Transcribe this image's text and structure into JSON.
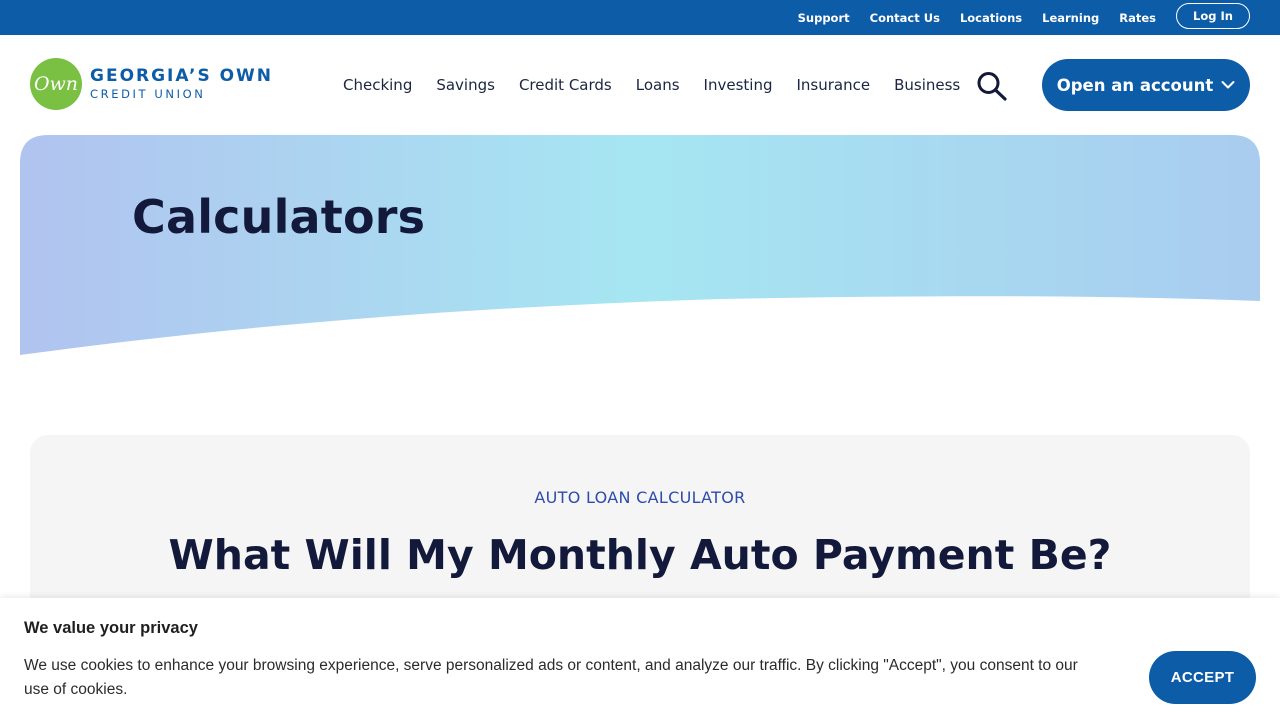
{
  "utility_nav": {
    "links": [
      "Support",
      "Contact Us",
      "Locations",
      "Learning",
      "Rates"
    ],
    "login_label": "Log In"
  },
  "brand": {
    "mark_text": "Own",
    "name_line1": "GEORGIA’S OWN",
    "name_line2": "CREDIT UNION",
    "primary_color": "#0d5ca8",
    "mark_color": "#7ac043"
  },
  "main_nav": {
    "items": [
      "Checking",
      "Savings",
      "Credit Cards",
      "Loans",
      "Investing",
      "Insurance",
      "Business"
    ],
    "search_icon": "search-icon",
    "cta_label": "Open an account",
    "cta_icon": "chevron-down-icon"
  },
  "hero": {
    "title": "Calculators"
  },
  "calculator": {
    "eyebrow": "AUTO LOAN CALCULATOR",
    "title": "What Will My Monthly Auto Payment Be?"
  },
  "cookie_banner": {
    "title": "We value your privacy",
    "text": "We use cookies to enhance your browsing experience, serve personalized ads or content, and analyze our traffic. By clicking \"Accept\", you consent to our use of cookies.",
    "accept_label": "ACCEPT"
  }
}
